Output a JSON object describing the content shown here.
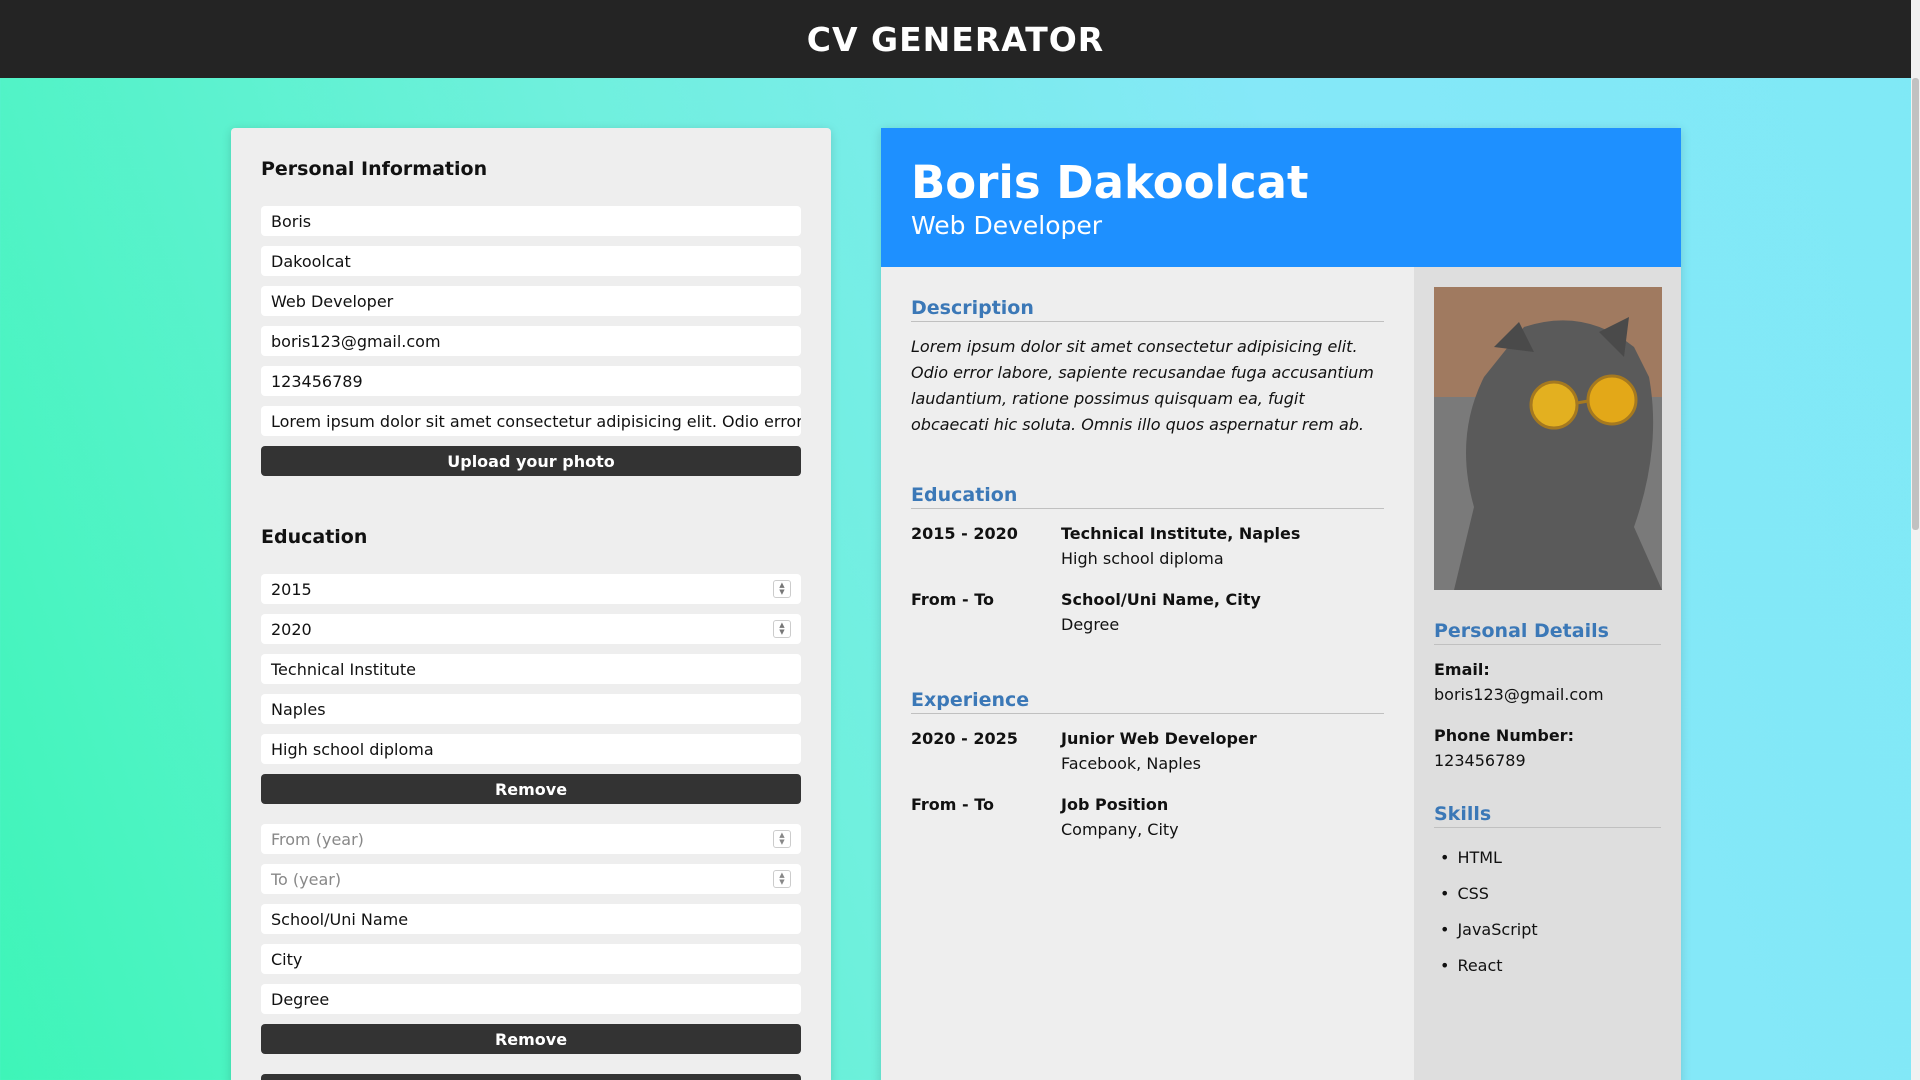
{
  "app": {
    "title": "CV GENERATOR"
  },
  "form": {
    "personal": {
      "heading": "Personal Information",
      "fields": [
        "Boris",
        "Dakoolcat",
        "Web Developer",
        "boris123@gmail.com",
        "123456789",
        "Lorem ipsum dolor sit amet consectetur adipisicing elit. Odio error lab"
      ],
      "upload_label": "Upload your photo"
    },
    "education": {
      "heading": "Education",
      "entry1": {
        "from": "2015",
        "to": "2020",
        "school": "Technical Institute",
        "city": "Naples",
        "degree": "High school diploma",
        "remove_label": "Remove"
      },
      "entry2": {
        "from_placeholder": "From (year)",
        "to_placeholder": "To (year)",
        "school": "School/Uni Name",
        "city": "City",
        "degree": "Degree",
        "remove_label": "Remove"
      }
    }
  },
  "cv": {
    "name": "Boris Dakoolcat",
    "title": "Web Developer",
    "description_heading": "Description",
    "description": "Lorem ipsum dolor sit amet consectetur adipisicing elit. Odio error labore, sapiente recusandae fuga accusantium laudantium, ratione possimus quisquam ea, fugit obcaecati hic soluta. Omnis illo quos aspernatur rem ab.",
    "education_heading": "Education",
    "education": [
      {
        "when": "2015 - 2020",
        "place": "Technical Institute, Naples",
        "detail": "High school diploma"
      },
      {
        "when": "From - To",
        "place": "School/Uni Name, City",
        "detail": "Degree"
      }
    ],
    "experience_heading": "Experience",
    "experience": [
      {
        "when": "2020 - 2025",
        "role": "Junior Web Developer",
        "detail": "Facebook, Naples"
      },
      {
        "when": "From - To",
        "role": "Job Position",
        "detail": "Company, City"
      }
    ],
    "personal_heading": "Personal Details",
    "email_label": "Email:",
    "email": "boris123@gmail.com",
    "phone_label": "Phone Number:",
    "phone": "123456789",
    "skills_heading": "Skills",
    "skills": [
      "HTML",
      "CSS",
      "JavaScript",
      "React"
    ]
  },
  "colors": {
    "header_bg": "#242424",
    "accent": "#1e90ff",
    "section_title": "#3b78b7",
    "button": "#333333"
  }
}
